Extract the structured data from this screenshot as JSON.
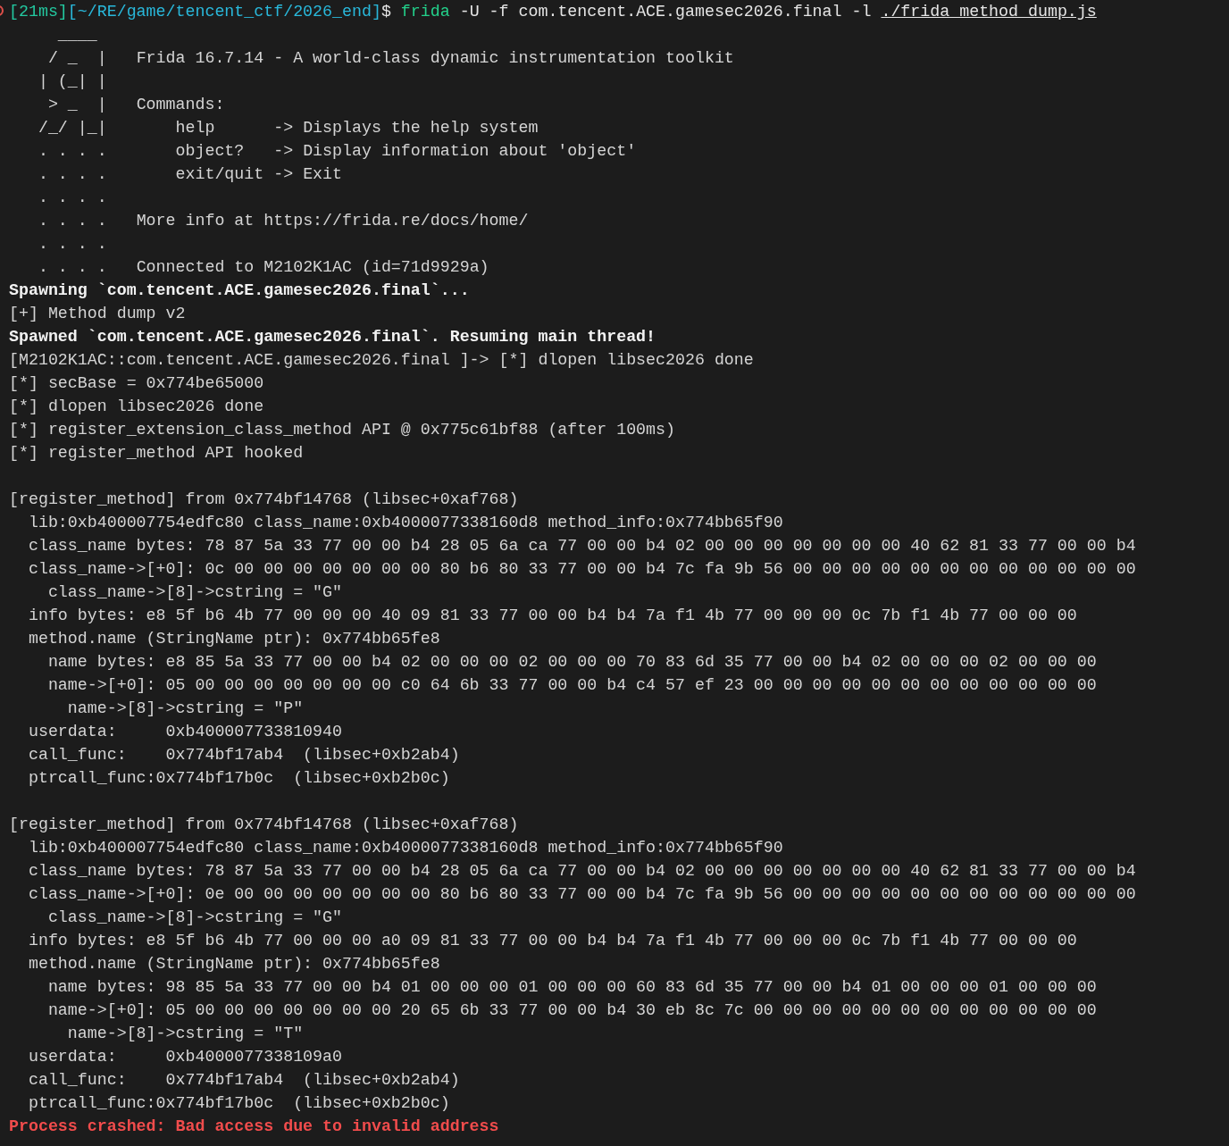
{
  "terminal": {
    "lines": [
      {
        "kind": "text",
        "parts": [
          {
            "kind": "time",
            "text": "[21ms]"
          },
          {
            "kind": "path",
            "text": "[~/RE/game/tencent_ctf/2026_end]"
          },
          {
            "kind": "symbol",
            "text": "$"
          },
          {
            "kind": "command",
            "text": " frida"
          },
          {
            "kind": "args",
            "text": " -U -f com.tencent.ACE.gamesec2026.final -l "
          },
          {
            "kind": "link",
            "text": "./frida_method_dump.js"
          }
        ]
      },
      {
        "kind": "text",
        "parts": [
          {
            "kind": "art",
            "text": "     ____"
          }
        ]
      },
      {
        "kind": "text",
        "parts": [
          {
            "kind": "art",
            "text": "    / _  |"
          },
          {
            "kind": "plain",
            "text": "   Frida 16.7.14 - A world-class dynamic instrumentation toolkit"
          }
        ]
      },
      {
        "kind": "text",
        "parts": [
          {
            "kind": "art",
            "text": "   | (_| |"
          }
        ]
      },
      {
        "kind": "text",
        "parts": [
          {
            "kind": "art",
            "text": "    > _  |"
          },
          {
            "kind": "plain",
            "text": "   Commands:"
          }
        ]
      },
      {
        "kind": "text",
        "parts": [
          {
            "kind": "art",
            "text": "   /_/ |_|"
          },
          {
            "kind": "plain",
            "text": "       help      -> Displays the help system"
          }
        ]
      },
      {
        "kind": "text",
        "parts": [
          {
            "kind": "art",
            "text": "   . . . ."
          },
          {
            "kind": "plain",
            "text": "       object?   -> Display information about 'object'"
          }
        ]
      },
      {
        "kind": "text",
        "parts": [
          {
            "kind": "art",
            "text": "   . . . ."
          },
          {
            "kind": "plain",
            "text": "       exit/quit -> Exit"
          }
        ]
      },
      {
        "kind": "text",
        "parts": [
          {
            "kind": "art",
            "text": "   . . . ."
          }
        ]
      },
      {
        "kind": "text",
        "parts": [
          {
            "kind": "art",
            "text": "   . . . ."
          },
          {
            "kind": "plain",
            "text": "   More info at https://frida.re/docs/home/"
          }
        ]
      },
      {
        "kind": "text",
        "parts": [
          {
            "kind": "art",
            "text": "   . . . ."
          }
        ]
      },
      {
        "kind": "text",
        "parts": [
          {
            "kind": "art",
            "text": "   . . . ."
          },
          {
            "kind": "plain",
            "text": "   Connected to M2102K1AC (id=71d9929a)"
          }
        ]
      },
      {
        "kind": "text",
        "parts": [
          {
            "kind": "bold",
            "text": "Spawning `com.tencent.ACE.gamesec2026.final`..."
          }
        ]
      },
      {
        "kind": "text",
        "parts": [
          {
            "kind": "plain",
            "text": "[+] Method dump v2"
          }
        ]
      },
      {
        "kind": "text",
        "parts": [
          {
            "kind": "bold",
            "text": "Spawned `com.tencent.ACE.gamesec2026.final`. Resuming main thread!"
          }
        ]
      },
      {
        "kind": "text",
        "parts": [
          {
            "kind": "plain",
            "text": "[M2102K1AC::com.tencent.ACE.gamesec2026.final ]-> [*] dlopen libsec2026 done"
          }
        ]
      },
      {
        "kind": "text",
        "parts": [
          {
            "kind": "plain",
            "text": "[*] secBase = 0x774be65000"
          }
        ]
      },
      {
        "kind": "text",
        "parts": [
          {
            "kind": "plain",
            "text": "[*] dlopen libsec2026 done"
          }
        ]
      },
      {
        "kind": "text",
        "parts": [
          {
            "kind": "plain",
            "text": "[*] register_extension_class_method API @ 0x775c61bf88 (after 100ms)"
          }
        ]
      },
      {
        "kind": "text",
        "parts": [
          {
            "kind": "plain",
            "text": "[*] register_method API hooked"
          }
        ]
      },
      {
        "kind": "blank"
      },
      {
        "kind": "text",
        "parts": [
          {
            "kind": "plain",
            "text": "[register_method] from 0x774bf14768 (libsec+0xaf768)"
          }
        ]
      },
      {
        "kind": "text",
        "parts": [
          {
            "kind": "plain",
            "text": "  lib:0xb400007754edfc80 class_name:0xb4000077338160d8 method_info:0x774bb65f90"
          }
        ]
      },
      {
        "kind": "text",
        "parts": [
          {
            "kind": "plain",
            "text": "  class_name bytes: 78 87 5a 33 77 00 00 b4 28 05 6a ca 77 00 00 b4 02 00 00 00 00 00 00 00 40 62 81 33 77 00 00 b4"
          }
        ]
      },
      {
        "kind": "text",
        "parts": [
          {
            "kind": "plain",
            "text": "  class_name->[+0]: 0c 00 00 00 00 00 00 00 80 b6 80 33 77 00 00 b4 7c fa 9b 56 00 00 00 00 00 00 00 00 00 00 00 00"
          }
        ]
      },
      {
        "kind": "text",
        "parts": [
          {
            "kind": "plain",
            "text": "    class_name->[8]->cstring = \"G\""
          }
        ]
      },
      {
        "kind": "text",
        "parts": [
          {
            "kind": "plain",
            "text": "  info bytes: e8 5f b6 4b 77 00 00 00 40 09 81 33 77 00 00 b4 b4 7a f1 4b 77 00 00 00 0c 7b f1 4b 77 00 00 00"
          }
        ]
      },
      {
        "kind": "text",
        "parts": [
          {
            "kind": "plain",
            "text": "  method.name (StringName ptr): 0x774bb65fe8"
          }
        ]
      },
      {
        "kind": "text",
        "parts": [
          {
            "kind": "plain",
            "text": "    name bytes: e8 85 5a 33 77 00 00 b4 02 00 00 00 02 00 00 00 70 83 6d 35 77 00 00 b4 02 00 00 00 02 00 00 00"
          }
        ]
      },
      {
        "kind": "text",
        "parts": [
          {
            "kind": "plain",
            "text": "    name->[+0]: 05 00 00 00 00 00 00 00 c0 64 6b 33 77 00 00 b4 c4 57 ef 23 00 00 00 00 00 00 00 00 00 00 00 00"
          }
        ]
      },
      {
        "kind": "text",
        "parts": [
          {
            "kind": "plain",
            "text": "      name->[8]->cstring = \"P\""
          }
        ]
      },
      {
        "kind": "text",
        "parts": [
          {
            "kind": "plain",
            "text": "  userdata:     0xb400007733810940"
          }
        ]
      },
      {
        "kind": "text",
        "parts": [
          {
            "kind": "plain",
            "text": "  call_func:    0x774bf17ab4  (libsec+0xb2ab4)"
          }
        ]
      },
      {
        "kind": "text",
        "parts": [
          {
            "kind": "plain",
            "text": "  ptrcall_func:0x774bf17b0c  (libsec+0xb2b0c)"
          }
        ]
      },
      {
        "kind": "blank"
      },
      {
        "kind": "text",
        "parts": [
          {
            "kind": "plain",
            "text": "[register_method] from 0x774bf14768 (libsec+0xaf768)"
          }
        ]
      },
      {
        "kind": "text",
        "parts": [
          {
            "kind": "plain",
            "text": "  lib:0xb400007754edfc80 class_name:0xb4000077338160d8 method_info:0x774bb65f90"
          }
        ]
      },
      {
        "kind": "text",
        "parts": [
          {
            "kind": "plain",
            "text": "  class_name bytes: 78 87 5a 33 77 00 00 b4 28 05 6a ca 77 00 00 b4 02 00 00 00 00 00 00 00 40 62 81 33 77 00 00 b4"
          }
        ]
      },
      {
        "kind": "text",
        "parts": [
          {
            "kind": "plain",
            "text": "  class_name->[+0]: 0e 00 00 00 00 00 00 00 80 b6 80 33 77 00 00 b4 7c fa 9b 56 00 00 00 00 00 00 00 00 00 00 00 00"
          }
        ]
      },
      {
        "kind": "text",
        "parts": [
          {
            "kind": "plain",
            "text": "    class_name->[8]->cstring = \"G\""
          }
        ]
      },
      {
        "kind": "text",
        "parts": [
          {
            "kind": "plain",
            "text": "  info bytes: e8 5f b6 4b 77 00 00 00 a0 09 81 33 77 00 00 b4 b4 7a f1 4b 77 00 00 00 0c 7b f1 4b 77 00 00 00"
          }
        ]
      },
      {
        "kind": "text",
        "parts": [
          {
            "kind": "plain",
            "text": "  method.name (StringName ptr): 0x774bb65fe8"
          }
        ]
      },
      {
        "kind": "text",
        "parts": [
          {
            "kind": "plain",
            "text": "    name bytes: 98 85 5a 33 77 00 00 b4 01 00 00 00 01 00 00 00 60 83 6d 35 77 00 00 b4 01 00 00 00 01 00 00 00"
          }
        ]
      },
      {
        "kind": "text",
        "parts": [
          {
            "kind": "plain",
            "text": "    name->[+0]: 05 00 00 00 00 00 00 00 20 65 6b 33 77 00 00 b4 30 eb 8c 7c 00 00 00 00 00 00 00 00 00 00 00 00"
          }
        ]
      },
      {
        "kind": "text",
        "parts": [
          {
            "kind": "plain",
            "text": "      name->[8]->cstring = \"T\""
          }
        ]
      },
      {
        "kind": "text",
        "parts": [
          {
            "kind": "plain",
            "text": "  userdata:     0xb4000077338109a0"
          }
        ]
      },
      {
        "kind": "text",
        "parts": [
          {
            "kind": "plain",
            "text": "  call_func:    0x774bf17ab4  (libsec+0xb2ab4)"
          }
        ]
      },
      {
        "kind": "text",
        "parts": [
          {
            "kind": "plain",
            "text": "  ptrcall_func:0x774bf17b0c  (libsec+0xb2b0c)"
          }
        ]
      },
      {
        "kind": "text",
        "parts": [
          {
            "kind": "error",
            "text": "Process crashed: Bad access due to invalid address"
          }
        ]
      }
    ]
  }
}
